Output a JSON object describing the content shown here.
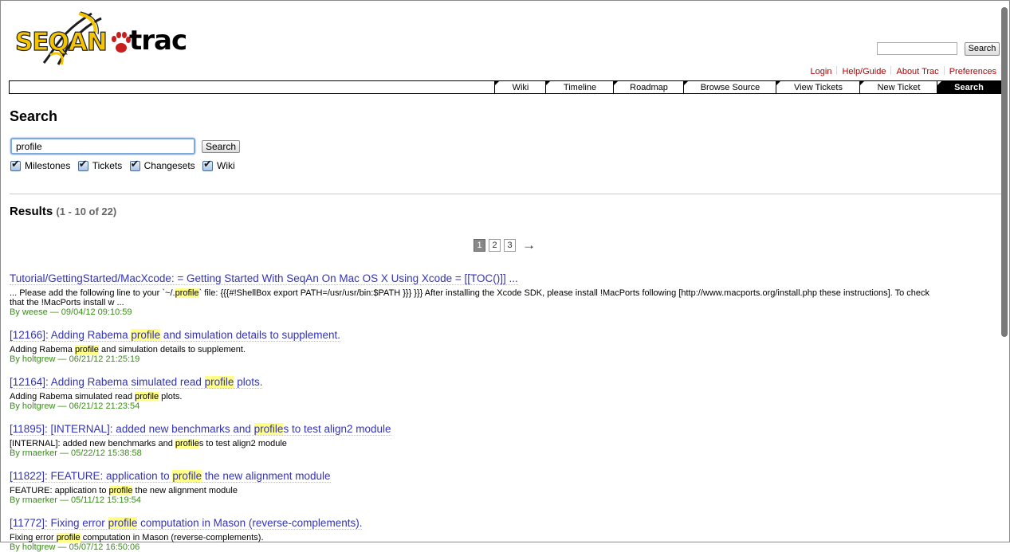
{
  "logo": {
    "primary": "SEQAN",
    "secondary": "trac"
  },
  "top_search": {
    "button": "Search",
    "value": ""
  },
  "metanav": [
    "Login",
    "Help/Guide",
    "About Trac",
    "Preferences"
  ],
  "mainnav": [
    "Wiki",
    "Timeline",
    "Roadmap",
    "Browse Source",
    "View Tickets",
    "New Ticket",
    "Search"
  ],
  "main": {
    "title": "Search",
    "query": "profile",
    "button": "Search",
    "filters": [
      "Milestones",
      "Tickets",
      "Changesets",
      "Wiki"
    ]
  },
  "results": {
    "label": "Results",
    "count": "(1 - 10 of 22)",
    "pages": [
      "1",
      "2",
      "3"
    ],
    "next": "→",
    "items": [
      {
        "title": "Tutorial/GettingStarted/MacXcode: = Getting Started With SeqAn On Mac OS X Using Xcode = [[TOC()]] ...",
        "excerpt_a": "... Please add the following line to your `~/.",
        "excerpt_hl": "profile",
        "excerpt_b": "` file: {{{#!ShellBox export PATH=/usr/usr/bin:$PATH }}} }}} After installing the Xcode SDK, please install !MacPorts following [http://www.macports.org/install.php these instructions]. To check that the !MacPorts install w ...",
        "author": "By weese — 09/04/12 09:10:59"
      },
      {
        "title_a": "[12166]: Adding Rabema ",
        "title_hl": "profile",
        "title_b": " and simulation details to supplement.",
        "excerpt_a": "Adding Rabema ",
        "excerpt_hl": "profile",
        "excerpt_b": " and simulation details to supplement.",
        "author": "By holtgrew — 06/21/12 21:25:19"
      },
      {
        "title_a": "[12164]: Adding Rabema simulated read ",
        "title_hl": "profile",
        "title_b": " plots.",
        "excerpt_a": "Adding Rabema simulated read ",
        "excerpt_hl": "profile",
        "excerpt_b": " plots.",
        "author": "By holtgrew — 06/21/12 21:23:54"
      },
      {
        "title_a": "[11895]: [INTERNAL]: added new benchmarks and ",
        "title_hl": "profile",
        "title_b": "s to test align2 module",
        "excerpt_a": "[INTERNAL]: added new benchmarks and ",
        "excerpt_hl": "profile",
        "excerpt_b": "s to test align2 module",
        "author": "By rmaerker — 05/22/12 15:38:58"
      },
      {
        "title_a": "[11822]: FEATURE: application to ",
        "title_hl": "profile",
        "title_b": " the new alignment module",
        "excerpt_a": "FEATURE: application to ",
        "excerpt_hl": "profile",
        "excerpt_b": " the new alignment module",
        "author": "By rmaerker — 05/11/12 15:19:54"
      },
      {
        "title_a": "[11772]: Fixing error ",
        "title_hl": "profile",
        "title_b": " computation in Mason (reverse-complements).",
        "excerpt_a": "Fixing error ",
        "excerpt_hl": "profile",
        "excerpt_b": " computation in Mason (reverse-complements).",
        "author": "By holtgrew — 05/07/12 16:50:06"
      }
    ]
  }
}
